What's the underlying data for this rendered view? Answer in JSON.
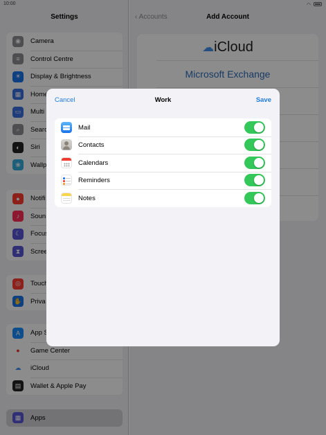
{
  "status_bar": {
    "time": "10:00"
  },
  "sidebar": {
    "title": "Settings",
    "groups": [
      [
        {
          "label": "Camera",
          "icon": "camera-icon",
          "color": "#8e8e93"
        },
        {
          "label": "Control Centre",
          "icon": "control-centre-icon",
          "color": "#8e8e93"
        },
        {
          "label": "Display & Brightness",
          "icon": "display-brightness-icon",
          "color": "#1a73e8"
        },
        {
          "label": "Home",
          "icon": "home-screen-icon",
          "color": "#3a6fe0"
        },
        {
          "label": "Multi",
          "icon": "multitasking-icon",
          "color": "#3a6fe0"
        },
        {
          "label": "Searc",
          "icon": "search-icon",
          "color": "#8e8e93"
        },
        {
          "label": "Siri",
          "icon": "siri-icon",
          "color": "#222222"
        },
        {
          "label": "Wallp",
          "icon": "wallpaper-icon",
          "color": "#34aadc"
        }
      ],
      [
        {
          "label": "Notifi",
          "icon": "notifications-icon",
          "color": "#ff3b30"
        },
        {
          "label": "Soun",
          "icon": "sounds-icon",
          "color": "#ff2d55"
        },
        {
          "label": "Focus",
          "icon": "focus-icon",
          "color": "#5856d6"
        },
        {
          "label": "Scree",
          "icon": "screen-time-icon",
          "color": "#5856d6"
        }
      ],
      [
        {
          "label": "Touch",
          "icon": "touch-id-icon",
          "color": "#ff3b30"
        },
        {
          "label": "Priva",
          "icon": "privacy-icon",
          "color": "#1a73e8"
        }
      ],
      [
        {
          "label": "App S",
          "icon": "app-store-icon",
          "color": "#1a8cff"
        },
        {
          "label": "Game Center",
          "icon": "game-center-icon",
          "color": "#ffffff"
        },
        {
          "label": "iCloud",
          "icon": "icloud-icon",
          "color": "#ffffff"
        },
        {
          "label": "Wallet & Apple Pay",
          "icon": "wallet-icon",
          "color": "#222222"
        }
      ]
    ],
    "apps_label": "Apps"
  },
  "main": {
    "back_label": "Accounts",
    "title": "Add Account",
    "providers": [
      "iCloud",
      "Microsoft Exchange"
    ]
  },
  "modal": {
    "cancel_label": "Cancel",
    "title": "Work",
    "save_label": "Save",
    "accent": "#1e7bd9",
    "toggle_on_color": "#34c759",
    "items": [
      {
        "label": "Mail",
        "icon": "mail-icon",
        "on": true
      },
      {
        "label": "Contacts",
        "icon": "contacts-icon",
        "on": true
      },
      {
        "label": "Calendars",
        "icon": "calendar-icon",
        "on": true
      },
      {
        "label": "Reminders",
        "icon": "reminders-icon",
        "on": true
      },
      {
        "label": "Notes",
        "icon": "notes-icon",
        "on": true
      }
    ]
  }
}
